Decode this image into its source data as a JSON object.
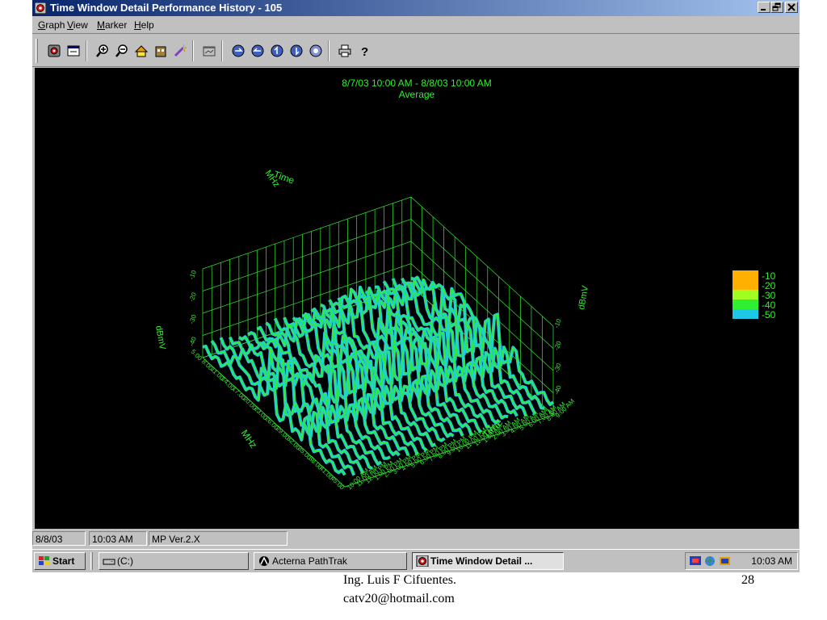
{
  "window": {
    "title": "Time Window Detail Performance History - 105",
    "app_icon": "red-app-icon"
  },
  "menu": {
    "items": [
      "Graph",
      "View",
      "Marker",
      "Help"
    ]
  },
  "toolbar": {
    "icons": [
      "settings-icon",
      "properties-icon",
      "zoom-in-icon",
      "zoom-out-icon",
      "home-icon",
      "building-icon",
      "wand-icon",
      "chart-window-icon",
      "rotate-left-icon",
      "rotate-right-icon",
      "rotate-up-icon",
      "rotate-down-icon",
      "reset-view-icon",
      "print-icon",
      "help-icon"
    ]
  },
  "chart_data": {
    "type": "area",
    "title": "8/7/03 10:00 AM - 8/8/03 10:00 AM",
    "subtitle": "Average",
    "xlabel": "MHz",
    "ylabel": "Time",
    "zlabel": "dBmV",
    "frequency_ticks": [
      "5.00",
      "8.00",
      "11.00",
      "14.00",
      "17.00",
      "20.00",
      "23.00",
      "26.00",
      "29.00",
      "32.00",
      "35.00",
      "38.00",
      "41.00",
      "45.00"
    ],
    "time_ticks": [
      "9:00 AM",
      "8:00 AM",
      "7:00 AM",
      "6:00 AM",
      "5:00 AM",
      "4:00 AM",
      "3:00 AM",
      "2:00 AM",
      "1:00 AM",
      "12:00 AM",
      "11:00 PM",
      "10:00 PM",
      "9:00 PM",
      "8:00 PM",
      "7:00 PM",
      "6:00 PM",
      "5:00 PM",
      "4:00 PM",
      "3:00 PM",
      "2:00 PM",
      "1:00 PM",
      "12:00 PM",
      "11:00 AM",
      "10:00 AM"
    ],
    "zticks": [
      "-10",
      "-20",
      "-30",
      "-40"
    ],
    "series_count": 24,
    "legend": {
      "placement": "right",
      "entries": [
        {
          "label": "-10",
          "color": "#ffb000"
        },
        {
          "label": "-20",
          "color": "#a0ff20"
        },
        {
          "label": "-30",
          "color": "#30ee30"
        },
        {
          "label": "-40",
          "color": "#30ee30"
        },
        {
          "label": "-50",
          "color": "#20c8e8"
        }
      ]
    },
    "grid": true
  },
  "status": {
    "date": "8/8/03",
    "time": "10:03 AM",
    "version": "MP Ver.2.X"
  },
  "taskbar": {
    "start": "Start",
    "buttons": [
      "(C:)",
      "Acterna PathTrak",
      "Time Window Detail ..."
    ],
    "clock": "10:03 AM"
  },
  "footer": {
    "author": "Ing. Luis F Cifuentes.",
    "email": "catv20@hotmail.com",
    "page": "28"
  }
}
